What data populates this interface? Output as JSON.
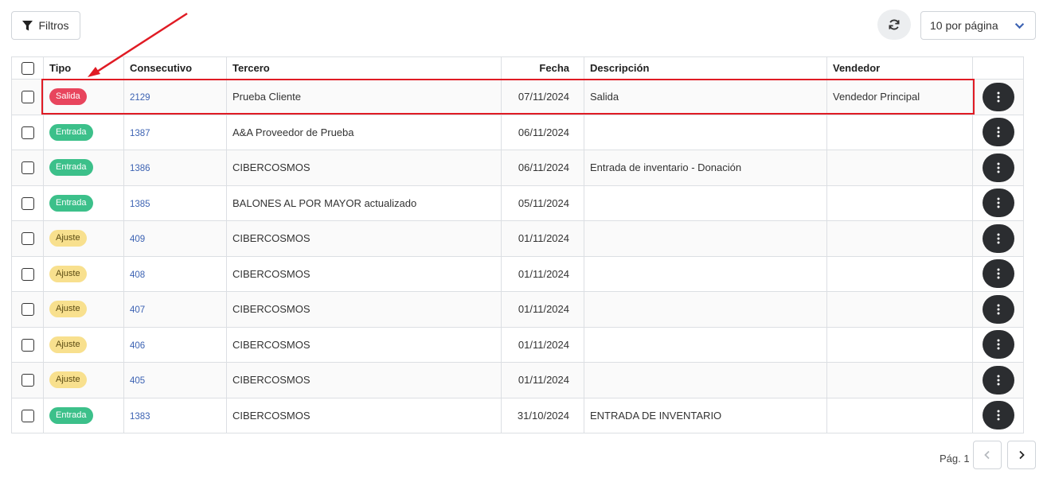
{
  "toolbar": {
    "filter_label": "Filtros",
    "per_page_value": "10 por página"
  },
  "table": {
    "headers": {
      "tipo": "Tipo",
      "consecutivo": "Consecutivo",
      "tercero": "Tercero",
      "fecha": "Fecha",
      "descripcion": "Descripción",
      "vendedor": "Vendedor"
    },
    "rows": [
      {
        "tipo": "Salida",
        "consecutivo": "2129",
        "tercero": "Prueba Cliente",
        "fecha": "07/11/2024",
        "descripcion": "Salida",
        "vendedor": "Vendedor Principal"
      },
      {
        "tipo": "Entrada",
        "consecutivo": "1387",
        "tercero": "A&A Proveedor de Prueba",
        "fecha": "06/11/2024",
        "descripcion": "",
        "vendedor": ""
      },
      {
        "tipo": "Entrada",
        "consecutivo": "1386",
        "tercero": "CIBERCOSMOS",
        "fecha": "06/11/2024",
        "descripcion": "Entrada de inventario - Donación",
        "vendedor": ""
      },
      {
        "tipo": "Entrada",
        "consecutivo": "1385",
        "tercero": "BALONES AL POR MAYOR actualizado",
        "fecha": "05/11/2024",
        "descripcion": "",
        "vendedor": ""
      },
      {
        "tipo": "Ajuste",
        "consecutivo": "409",
        "tercero": "CIBERCOSMOS",
        "fecha": "01/11/2024",
        "descripcion": "",
        "vendedor": ""
      },
      {
        "tipo": "Ajuste",
        "consecutivo": "408",
        "tercero": "CIBERCOSMOS",
        "fecha": "01/11/2024",
        "descripcion": "",
        "vendedor": ""
      },
      {
        "tipo": "Ajuste",
        "consecutivo": "407",
        "tercero": "CIBERCOSMOS",
        "fecha": "01/11/2024",
        "descripcion": "",
        "vendedor": ""
      },
      {
        "tipo": "Ajuste",
        "consecutivo": "406",
        "tercero": "CIBERCOSMOS",
        "fecha": "01/11/2024",
        "descripcion": "",
        "vendedor": ""
      },
      {
        "tipo": "Ajuste",
        "consecutivo": "405",
        "tercero": "CIBERCOSMOS",
        "fecha": "01/11/2024",
        "descripcion": "",
        "vendedor": ""
      },
      {
        "tipo": "Entrada",
        "consecutivo": "1383",
        "tercero": "CIBERCOSMOS",
        "fecha": "31/10/2024",
        "descripcion": "ENTRADA DE INVENTARIO",
        "vendedor": ""
      }
    ]
  },
  "pagination": {
    "label": "Pág. 1"
  },
  "colors": {
    "salida": "#e8455d",
    "entrada": "#3cc08a",
    "ajuste": "#f8e08e",
    "link": "#3d63b3",
    "annotation": "#e01b24",
    "action_button": "#2b2d30"
  },
  "icons": {
    "filter": "filter-icon",
    "refresh": "refresh-icon",
    "dropdown": "chevron-down-icon",
    "row_actions": "more-vertical-icon",
    "prev": "chevron-left-icon",
    "next": "chevron-right-icon"
  }
}
